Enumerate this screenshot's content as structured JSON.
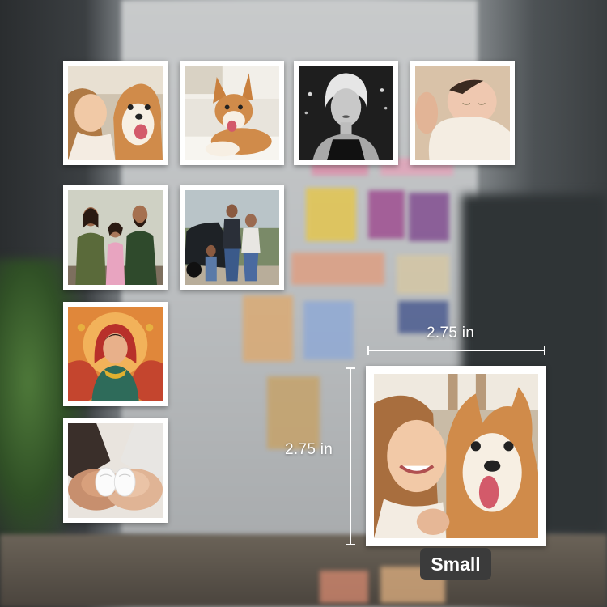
{
  "size_indicator": {
    "width_label": "2.75 in",
    "height_label": "2.75 in",
    "size_name": "Small"
  },
  "photos": [
    {
      "subject": "woman-with-corgi"
    },
    {
      "subject": "corgi-on-sofa"
    },
    {
      "subject": "black-and-white-portrait"
    },
    {
      "subject": "newborn-baby"
    },
    {
      "subject": "family-portrait"
    },
    {
      "subject": "family-with-car"
    },
    {
      "subject": "illustrated-woman"
    },
    {
      "subject": "baby-shoes-in-hands"
    },
    {
      "subject": "woman-with-corgi-large"
    }
  ],
  "colors": {
    "frame": "#ffffff",
    "badge_bg": "#3b3b3b",
    "indicator": "#ffffff"
  }
}
